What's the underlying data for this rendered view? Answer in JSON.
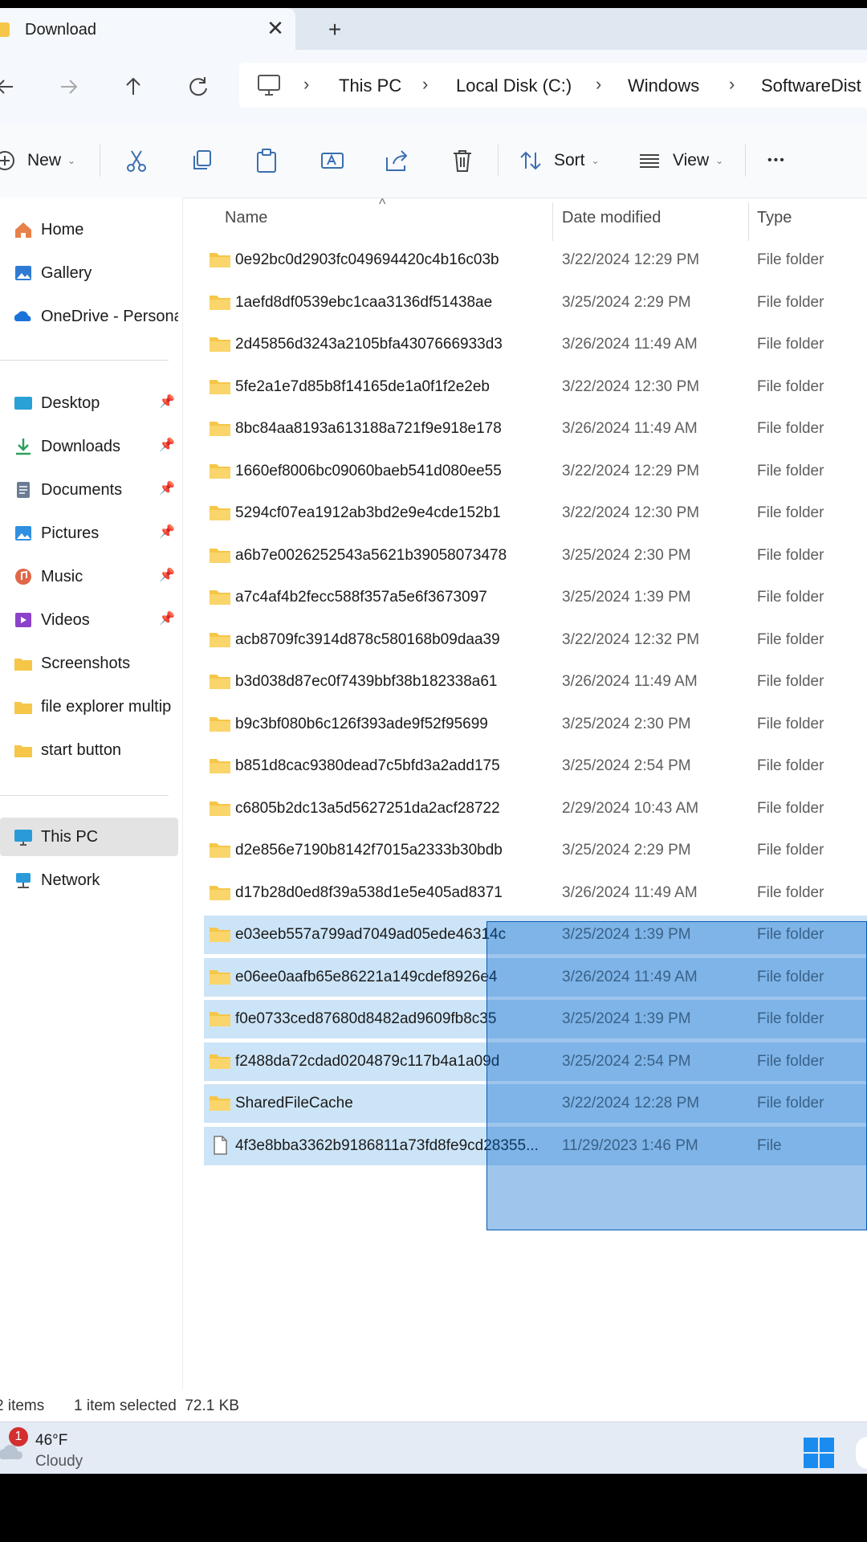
{
  "window": {
    "tab_title": "Download",
    "close_tab_glyph": "✕",
    "new_tab_glyph": "+"
  },
  "address": {
    "crumbs": [
      "This PC",
      "Local Disk (C:)",
      "Windows",
      "SoftwareDist"
    ],
    "separator": "›"
  },
  "toolbar": {
    "new_label": "New",
    "sort_label": "Sort",
    "view_label": "View",
    "more_glyph": "•••"
  },
  "sidebar": {
    "top": [
      {
        "label": "Home",
        "icon": "home-icon"
      },
      {
        "label": "Gallery",
        "icon": "gallery-icon"
      },
      {
        "label": "OneDrive - Persona",
        "icon": "onedrive-icon"
      }
    ],
    "pinned": [
      {
        "label": "Desktop",
        "icon": "desktop-icon"
      },
      {
        "label": "Downloads",
        "icon": "downloads-icon"
      },
      {
        "label": "Documents",
        "icon": "documents-icon"
      },
      {
        "label": "Pictures",
        "icon": "pictures-icon"
      },
      {
        "label": "Music",
        "icon": "music-icon"
      },
      {
        "label": "Videos",
        "icon": "videos-icon"
      },
      {
        "label": "Screenshots",
        "icon": "folder-icon"
      },
      {
        "label": "file explorer multip",
        "icon": "folder-icon"
      },
      {
        "label": "start button",
        "icon": "folder-icon"
      }
    ],
    "bottom": [
      {
        "label": "This PC",
        "icon": "this-pc-icon"
      },
      {
        "label": "Network",
        "icon": "network-icon"
      }
    ]
  },
  "columns": {
    "name": "Name",
    "date": "Date modified",
    "type": "Type",
    "sort_glyph": "^"
  },
  "files": [
    {
      "name": "0e92bc0d2903fc049694420c4b16c03b",
      "date": "3/22/2024 12:29 PM",
      "type": "File folder",
      "selected": false
    },
    {
      "name": "1aefd8df0539ebc1caa3136df51438ae",
      "date": "3/25/2024 2:29 PM",
      "type": "File folder",
      "selected": false
    },
    {
      "name": "2d45856d3243a2105bfa4307666933d3",
      "date": "3/26/2024 11:49 AM",
      "type": "File folder",
      "selected": false
    },
    {
      "name": "5fe2a1e7d85b8f14165de1a0f1f2e2eb",
      "date": "3/22/2024 12:30 PM",
      "type": "File folder",
      "selected": false
    },
    {
      "name": "8bc84aa8193a613188a721f9e918e178",
      "date": "3/26/2024 11:49 AM",
      "type": "File folder",
      "selected": false
    },
    {
      "name": "1660ef8006bc09060baeb541d080ee55",
      "date": "3/22/2024 12:29 PM",
      "type": "File folder",
      "selected": false
    },
    {
      "name": "5294cf07ea1912ab3bd2e9e4cde152b1",
      "date": "3/22/2024 12:30 PM",
      "type": "File folder",
      "selected": false
    },
    {
      "name": "a6b7e0026252543a5621b39058073478",
      "date": "3/25/2024 2:30 PM",
      "type": "File folder",
      "selected": false
    },
    {
      "name": "a7c4af4b2fecc588f357a5e6f3673097",
      "date": "3/25/2024 1:39 PM",
      "type": "File folder",
      "selected": false
    },
    {
      "name": "acb8709fc3914d878c580168b09daa39",
      "date": "3/22/2024 12:32 PM",
      "type": "File folder",
      "selected": false
    },
    {
      "name": "b3d038d87ec0f7439bbf38b182338a61",
      "date": "3/26/2024 11:49 AM",
      "type": "File folder",
      "selected": false
    },
    {
      "name": "b9c3bf080b6c126f393ade9f52f95699",
      "date": "3/25/2024 2:30 PM",
      "type": "File folder",
      "selected": false
    },
    {
      "name": "b851d8cac9380dead7c5bfd3a2add175",
      "date": "3/25/2024 2:54 PM",
      "type": "File folder",
      "selected": false
    },
    {
      "name": "c6805b2dc13a5d5627251da2acf28722",
      "date": "2/29/2024 10:43 AM",
      "type": "File folder",
      "selected": false
    },
    {
      "name": "d2e856e7190b8142f7015a2333b30bdb",
      "date": "3/25/2024 2:29 PM",
      "type": "File folder",
      "selected": false
    },
    {
      "name": "d17b28d0ed8f39a538d1e5e405ad8371",
      "date": "3/26/2024 11:49 AM",
      "type": "File folder",
      "selected": false
    },
    {
      "name": "e03eeb557a799ad7049ad05ede46314c",
      "date": "3/25/2024 1:39 PM",
      "type": "File folder",
      "selected": true
    },
    {
      "name": "e06ee0aafb65e86221a149cdef8926e4",
      "date": "3/26/2024 11:49 AM",
      "type": "File folder",
      "selected": true
    },
    {
      "name": "f0e0733ced87680d8482ad9609fb8c35",
      "date": "3/25/2024 1:39 PM",
      "type": "File folder",
      "selected": true
    },
    {
      "name": "f2488da72cdad0204879c117b4a1a09d",
      "date": "3/25/2024 2:54 PM",
      "type": "File folder",
      "selected": true
    },
    {
      "name": "SharedFileCache",
      "date": "3/22/2024 12:28 PM",
      "type": "File folder",
      "selected": true
    },
    {
      "name": "4f3e8bba3362b9186811a73fd8fe9cd28355...",
      "date": "11/29/2023 1:46 PM",
      "type": "File",
      "selected": true
    }
  ],
  "status": {
    "items": "2 items",
    "selected": "1 item selected  72.1 KB"
  },
  "taskbar": {
    "temperature": "46°F",
    "condition": "Cloudy",
    "badge": "1"
  },
  "colors": {
    "selection": "#cce4f7",
    "marquee": "#0066cc",
    "folder": "#f6c648"
  }
}
